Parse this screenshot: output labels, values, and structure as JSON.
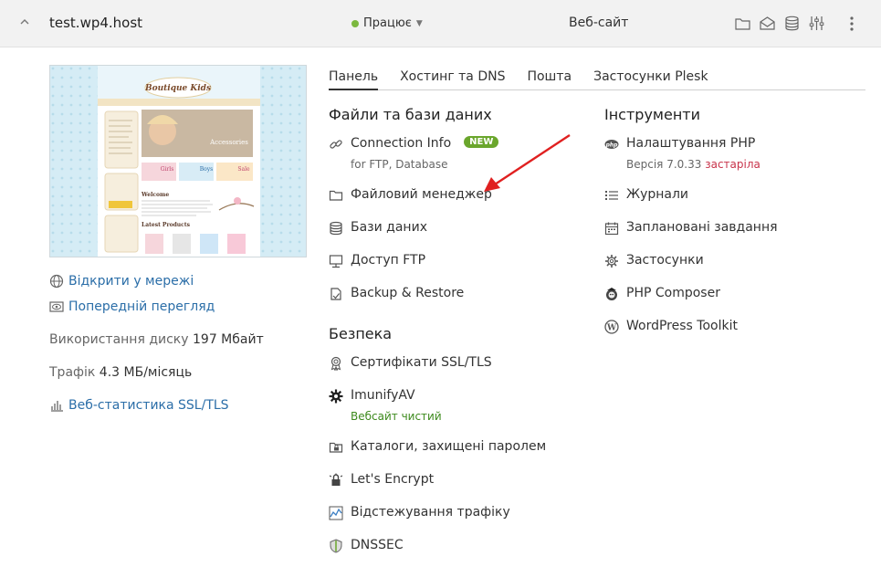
{
  "topbar": {
    "domain": "test.wp4.host",
    "status": "Працює",
    "site_type": "Веб-сайт"
  },
  "preview": {
    "site_name": "Boutique Kids",
    "accessories": "Accessories",
    "welcome": "Welcome",
    "latest": "Latest Products",
    "girls": "Girls",
    "boys": "Boys",
    "sale": "Sale"
  },
  "left": {
    "open_online": "Відкрити у мережі",
    "preview": "Попередній перегляд",
    "disk_label": "Використання диску",
    "disk_value": "197 Мбайт",
    "traffic_label": "Трафік",
    "traffic_value": "4.3 МБ/місяць",
    "web_stats": "Веб-статистика SSL/TLS"
  },
  "tabs": [
    "Панель",
    "Хостинг та DNS",
    "Пошта",
    "Застосунки Plesk"
  ],
  "files": {
    "title": "Файли та бази даних",
    "connection_info": "Connection Info",
    "new_badge": "NEW",
    "connection_sub": "for FTP, Database",
    "file_manager": "Файловий менеджер",
    "databases": "Бази даних",
    "ftp": "Доступ FTP",
    "backup": "Backup & Restore"
  },
  "security": {
    "title": "Безпека",
    "ssl": "Сертифікати SSL/TLS",
    "imunify": "ImunifyAV",
    "imunify_sub": "Вебсайт чистий",
    "protected_dirs": "Каталоги, захищені паролем",
    "letsencrypt": "Let's Encrypt",
    "traffic": "Відстежування трафіку",
    "dnssec": "DNSSEC"
  },
  "tools": {
    "title": "Інструменти",
    "php": "Налаштування PHP",
    "php_version_label": "Версія 7.0.33",
    "php_outdated": "застаріла",
    "logs": "Журнали",
    "scheduled": "Заплановані завдання",
    "apps": "Застосунки",
    "composer": "PHP Composer",
    "wp_toolkit": "WordPress Toolkit"
  },
  "colors": {
    "link": "#2b6ea8",
    "status_green": "#7cb83f",
    "badge": "#6aa62c",
    "outdated": "#c8344b",
    "arrow": "#e02020"
  }
}
